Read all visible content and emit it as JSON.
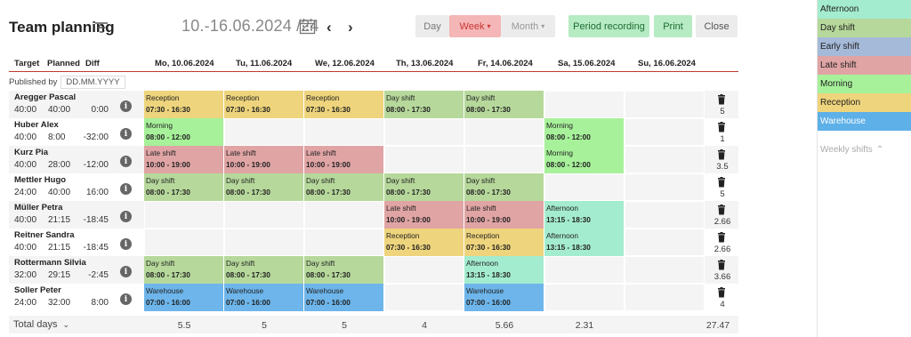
{
  "header": {
    "title": "Team planning",
    "date_range": "10.-16.06.2024",
    "week_label": "/24",
    "prev": "‹",
    "next": "›",
    "views": {
      "day": "Day",
      "week": "Week",
      "month": "Month"
    },
    "actions": {
      "period": "Period recording",
      "print": "Print",
      "close": "Close"
    }
  },
  "columns": {
    "target": "Target",
    "planned": "Planned",
    "diff": "Diff",
    "days": [
      "Mo, 10.06.2024",
      "Tu, 11.06.2024",
      "We, 12.06.2024",
      "Th, 13.06.2024",
      "Fr, 14.06.2024",
      "Sa, 15.06.2024",
      "Su, 16.06.2024"
    ]
  },
  "published": {
    "label": "Published by",
    "value": "DD.MM.YYYY"
  },
  "legend": [
    {
      "label": "Afternoon",
      "color": "#a4eccf"
    },
    {
      "label": "Day shift",
      "color": "#b6d89b"
    },
    {
      "label": "Early shift",
      "color": "#a5b9d8"
    },
    {
      "label": "Late shift",
      "color": "#e0a4a4"
    },
    {
      "label": "Morning",
      "color": "#a7f19a"
    },
    {
      "label": "Reception",
      "color": "#eed47c"
    },
    {
      "label": "Warehouse",
      "color": "#5eb0e8"
    }
  ],
  "weekly_shifts_label": "Weekly shifts",
  "colors": {
    "Afternoon": "#a4eccf",
    "Day shift": "#b6d89b",
    "Late shift": "#e0a4a4",
    "Morning": "#a7f19a",
    "Reception": "#eed47c",
    "Warehouse": "#6db5ea"
  },
  "employees": [
    {
      "name": "Aregger Pascal",
      "target": "40:00",
      "planned": "40:00",
      "diff": "0:00",
      "total": "5",
      "shifts": [
        {
          "day": 0,
          "name": "Reception",
          "time": "07:30 - 16:30"
        },
        {
          "day": 1,
          "name": "Reception",
          "time": "07:30 - 16:30"
        },
        {
          "day": 2,
          "name": "Reception",
          "time": "07:30 - 16:30"
        },
        {
          "day": 3,
          "name": "Day shift",
          "time": "08:00 - 17:30"
        },
        {
          "day": 4,
          "name": "Day shift",
          "time": "08:00 - 17:30"
        }
      ]
    },
    {
      "name": "Huber Alex",
      "target": "40:00",
      "planned": "8:00",
      "diff": "-32:00",
      "total": "1",
      "shifts": [
        {
          "day": 0,
          "name": "Morning",
          "time": "08:00 - 12:00"
        },
        {
          "day": 5,
          "name": "Morning",
          "time": "08:00 - 12:00"
        }
      ]
    },
    {
      "name": "Kurz Pia",
      "target": "40:00",
      "planned": "28:00",
      "diff": "-12:00",
      "total": "3.5",
      "shifts": [
        {
          "day": 0,
          "name": "Late shift",
          "time": "10:00 - 19:00"
        },
        {
          "day": 1,
          "name": "Late shift",
          "time": "10:00 - 19:00"
        },
        {
          "day": 2,
          "name": "Late shift",
          "time": "10:00 - 19:00"
        },
        {
          "day": 5,
          "name": "Morning",
          "time": "08:00 - 12:00"
        }
      ]
    },
    {
      "name": "Mettler Hugo",
      "target": "24:00",
      "planned": "40:00",
      "diff": "16:00",
      "total": "5",
      "shifts": [
        {
          "day": 0,
          "name": "Day shift",
          "time": "08:00 - 17:30"
        },
        {
          "day": 1,
          "name": "Day shift",
          "time": "08:00 - 17:30"
        },
        {
          "day": 2,
          "name": "Day shift",
          "time": "08:00 - 17:30"
        },
        {
          "day": 3,
          "name": "Day shift",
          "time": "08:00 - 17:30"
        },
        {
          "day": 4,
          "name": "Day shift",
          "time": "08:00 - 17:30"
        }
      ]
    },
    {
      "name": "Müller Petra",
      "target": "40:00",
      "planned": "21:15",
      "diff": "-18:45",
      "total": "2.66",
      "shifts": [
        {
          "day": 3,
          "name": "Late shift",
          "time": "10:00 - 19:00"
        },
        {
          "day": 4,
          "name": "Late shift",
          "time": "10:00 - 19:00"
        },
        {
          "day": 5,
          "name": "Afternoon",
          "time": "13:15 - 18:30"
        }
      ]
    },
    {
      "name": "Reitner Sandra",
      "target": "40:00",
      "planned": "21:15",
      "diff": "-18:45",
      "total": "2.66",
      "shifts": [
        {
          "day": 3,
          "name": "Reception",
          "time": "07:30 - 16:30"
        },
        {
          "day": 4,
          "name": "Reception",
          "time": "07:30 - 16:30"
        },
        {
          "day": 5,
          "name": "Afternoon",
          "time": "13:15 - 18:30"
        }
      ]
    },
    {
      "name": "Rottermann Silvia",
      "target": "32:00",
      "planned": "29:15",
      "diff": "-2:45",
      "total": "3.66",
      "shifts": [
        {
          "day": 0,
          "name": "Day shift",
          "time": "08:00 - 17:30"
        },
        {
          "day": 1,
          "name": "Day shift",
          "time": "08:00 - 17:30"
        },
        {
          "day": 2,
          "name": "Day shift",
          "time": "08:00 - 17:30"
        },
        {
          "day": 4,
          "name": "Afternoon",
          "time": "13:15 - 18:30"
        }
      ]
    },
    {
      "name": "Soller Peter",
      "target": "24:00",
      "planned": "32:00",
      "diff": "8:00",
      "total": "4",
      "shifts": [
        {
          "day": 0,
          "name": "Warehouse",
          "time": "07:00 - 16:00"
        },
        {
          "day": 1,
          "name": "Warehouse",
          "time": "07:00 - 16:00"
        },
        {
          "day": 2,
          "name": "Warehouse",
          "time": "07:00 - 16:00"
        },
        {
          "day": 4,
          "name": "Warehouse",
          "time": "07:00 - 16:00"
        }
      ]
    }
  ],
  "totals": {
    "label": "Total days",
    "per_day": [
      "5.5",
      "5",
      "5",
      "4",
      "5.66",
      "2.31",
      ""
    ],
    "grand": "27.47"
  }
}
